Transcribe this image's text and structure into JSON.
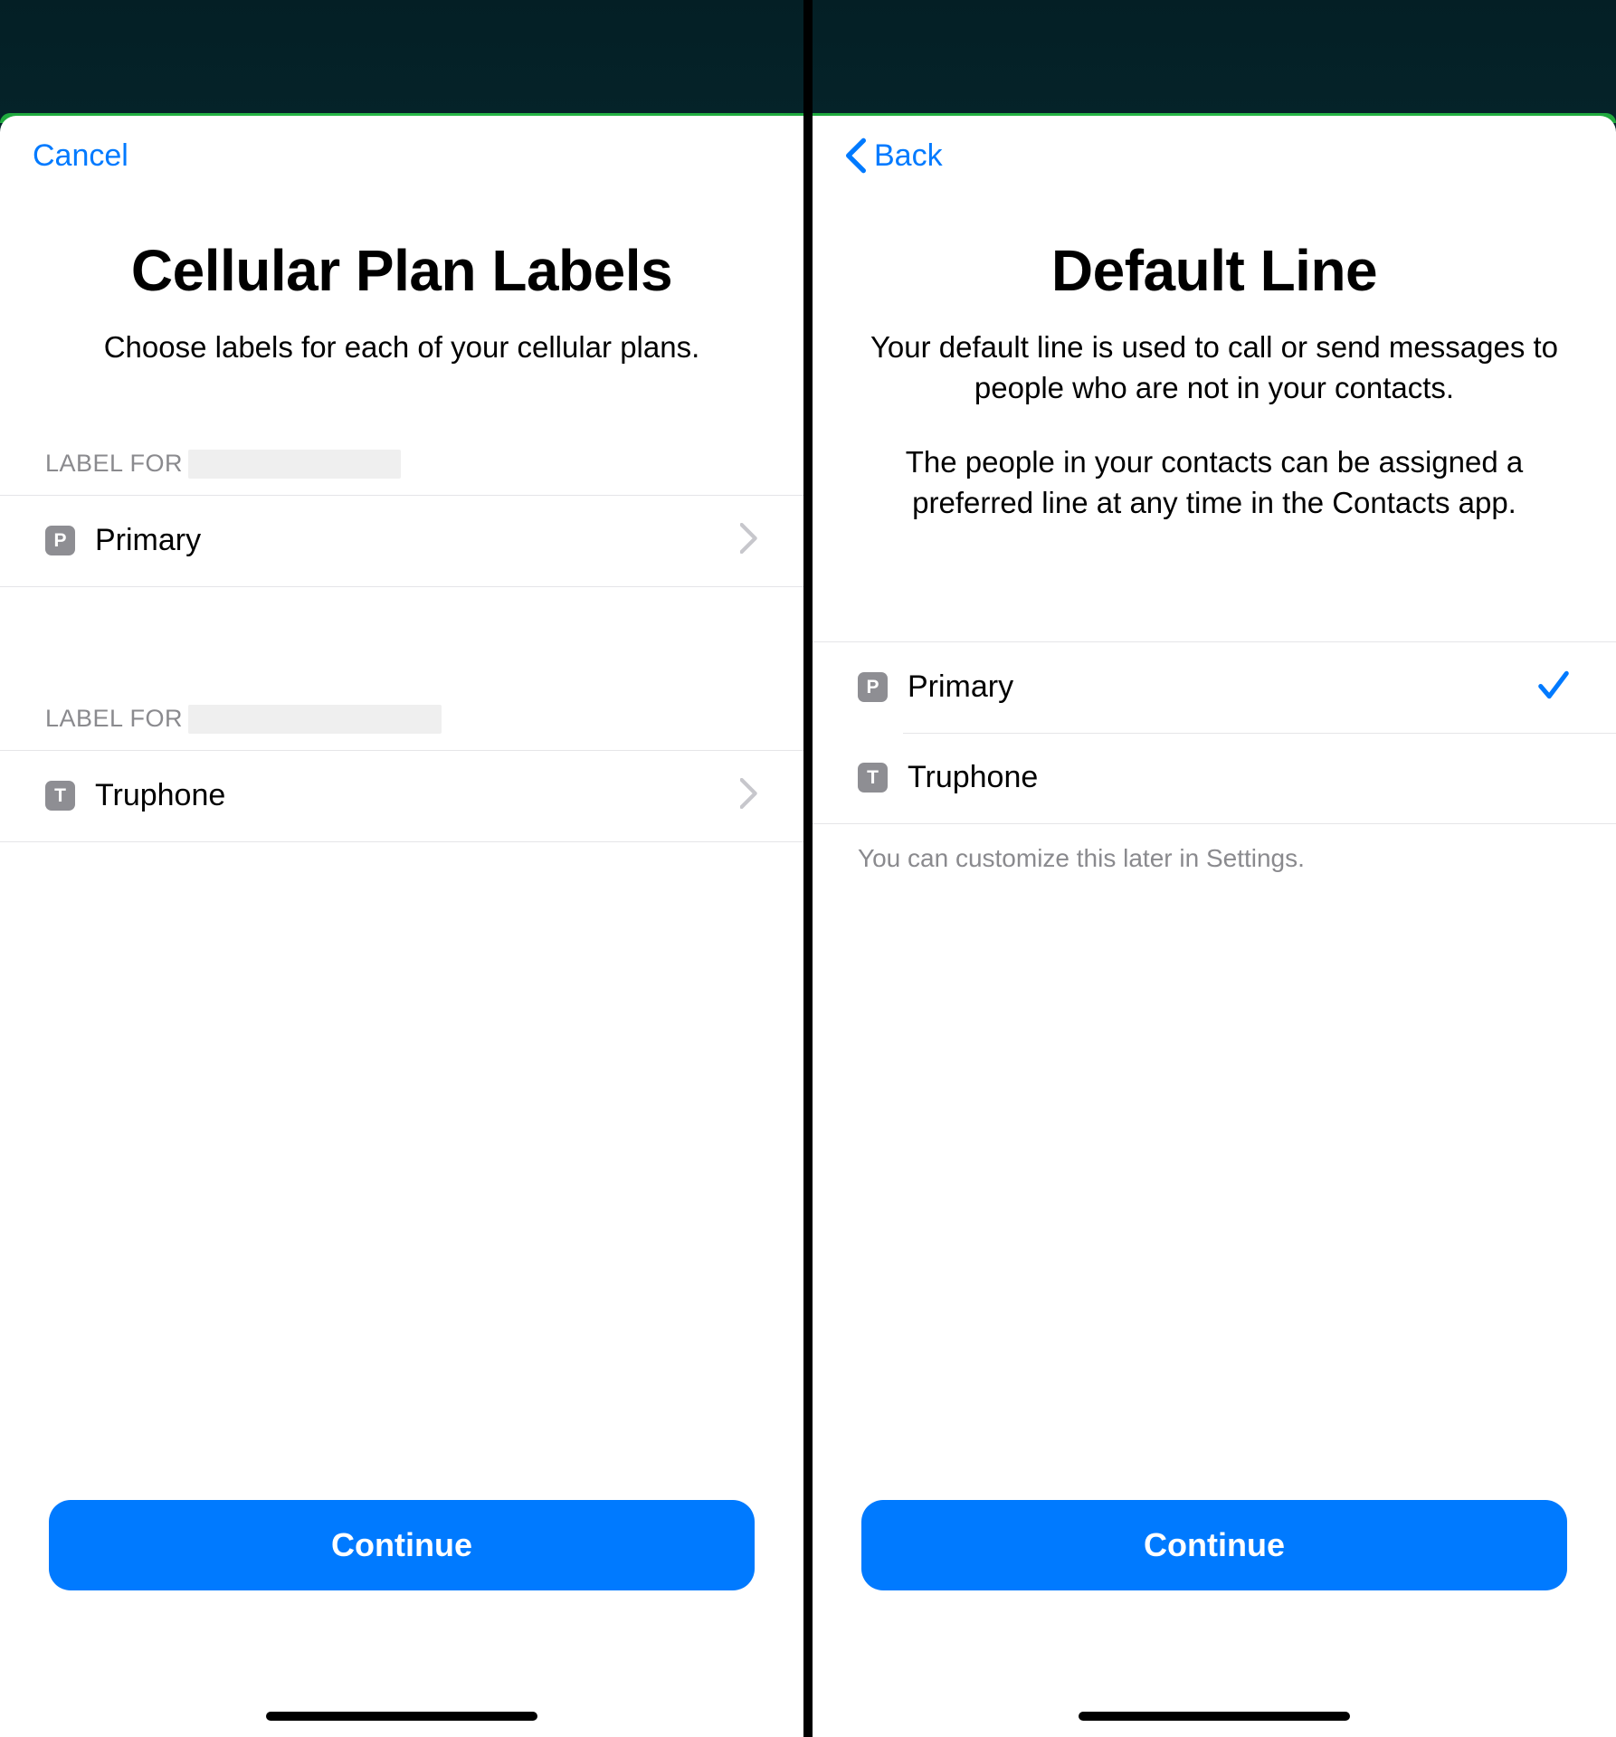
{
  "left": {
    "nav": {
      "cancel": "Cancel"
    },
    "title": "Cellular Plan Labels",
    "subtitle": "Choose labels for each of your cellular plans.",
    "section1_label": "LABEL FOR",
    "section2_label": "LABEL FOR",
    "row1": {
      "badge": "P",
      "label": "Primary"
    },
    "row2": {
      "badge": "T",
      "label": "Truphone"
    },
    "cta": "Continue"
  },
  "right": {
    "nav": {
      "back": "Back"
    },
    "title": "Default Line",
    "para1": "Your default line is used to call or send messages to people who are not in your contacts.",
    "para2": "The people in your contacts can be assigned a preferred line at any time in the Contacts app.",
    "options": [
      {
        "badge": "P",
        "label": "Primary",
        "selected": true
      },
      {
        "badge": "T",
        "label": "Truphone",
        "selected": false
      }
    ],
    "footer": "You can customize this later in Settings.",
    "cta": "Continue"
  }
}
